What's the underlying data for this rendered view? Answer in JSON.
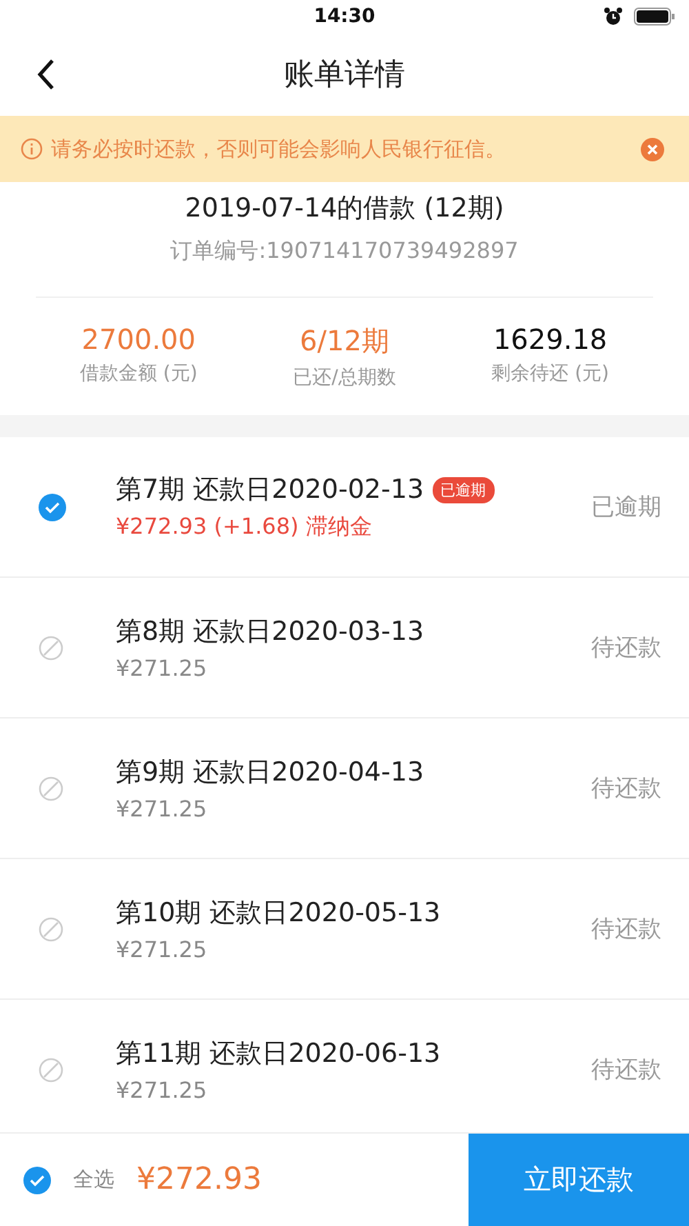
{
  "status_bar": {
    "time": "14:30"
  },
  "nav": {
    "title": "账单详情"
  },
  "notice": {
    "text": "请务必按时还款，否则可能会影响人民银行征信。"
  },
  "loan": {
    "title": "2019-07-14的借款 (12期)",
    "order": "订单编号:190714170739492897"
  },
  "stats": [
    {
      "value": "2700.00",
      "label": "借款金额 (元)",
      "highlight": true
    },
    {
      "value": "6/12期",
      "label": "已还/总期数",
      "highlight": true
    },
    {
      "value": "1629.18",
      "label": "剩余待还 (元)",
      "highlight": false
    }
  ],
  "installments": [
    {
      "title": "第7期 还款日2020-02-13",
      "badge": "已逾期",
      "amount": "¥272.93 (+1.68) 滞纳金",
      "status": "已逾期",
      "overdue": true,
      "checked": true,
      "disabled": false
    },
    {
      "title": "第8期 还款日2020-03-13",
      "amount": "¥271.25",
      "status": "待还款",
      "overdue": false,
      "checked": false,
      "disabled": true
    },
    {
      "title": "第9期 还款日2020-04-13",
      "amount": "¥271.25",
      "status": "待还款",
      "overdue": false,
      "checked": false,
      "disabled": true
    },
    {
      "title": "第10期 还款日2020-05-13",
      "amount": "¥271.25",
      "status": "待还款",
      "overdue": false,
      "checked": false,
      "disabled": true
    },
    {
      "title": "第11期 还款日2020-06-13",
      "amount": "¥271.25",
      "status": "待还款",
      "overdue": false,
      "checked": false,
      "disabled": true
    }
  ],
  "footer": {
    "select_all": {
      "label": "全选",
      "checked": true
    },
    "total": "¥272.93",
    "button": "立即还款"
  }
}
